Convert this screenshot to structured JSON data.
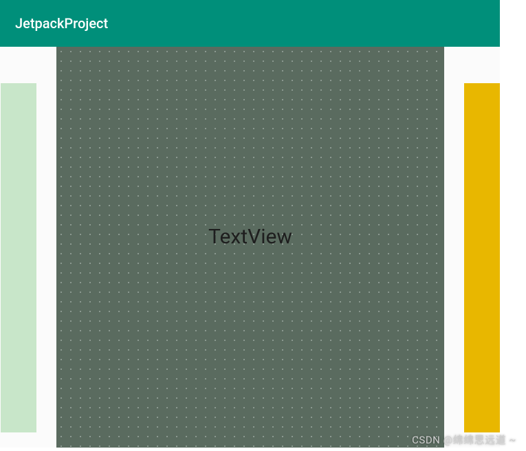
{
  "appBar": {
    "title": "JetpackProject"
  },
  "centerPanel": {
    "label": "TextView"
  },
  "colors": {
    "appBar": "#008f7a",
    "leftPanel": "#c8e6c9",
    "rightPanel": "#e8b700",
    "centerPanel": "#5a6b5f"
  },
  "watermark": "CSDN @绵绵思远道 ~"
}
